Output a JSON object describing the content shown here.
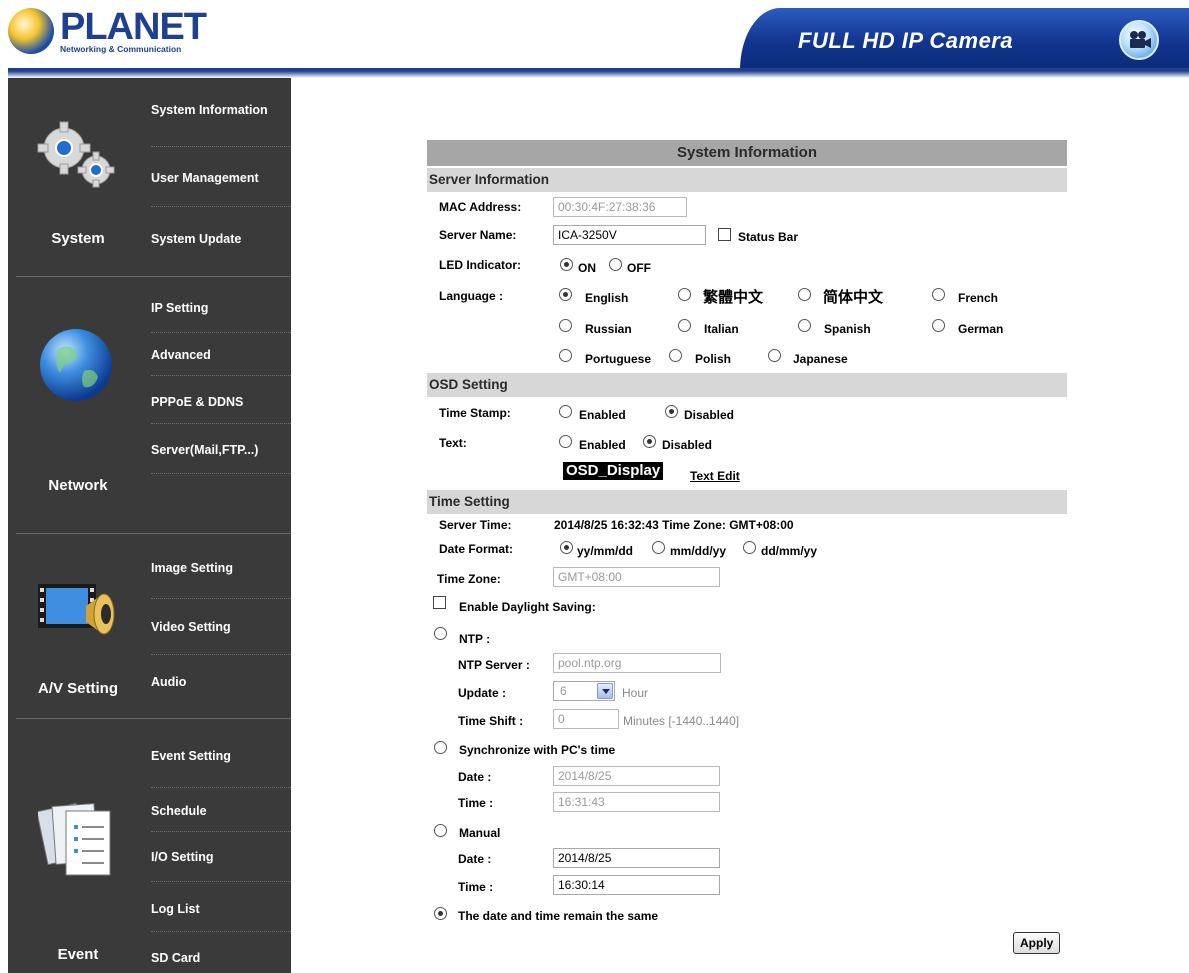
{
  "header": {
    "logo_title": "PLANET",
    "logo_subtitle": "Networking & Communication",
    "product_title": "FULL HD IP Camera"
  },
  "sidebar": {
    "groups": [
      {
        "label": "System",
        "icon": "gears-icon",
        "items": [
          "System Information",
          "User Management",
          "System Update"
        ]
      },
      {
        "label": "Network",
        "icon": "globe-icon",
        "items": [
          "IP Setting",
          "Advanced",
          "PPPoE & DDNS",
          "Server(Mail,FTP...)"
        ]
      },
      {
        "label": "A/V Setting",
        "icon": "film-speaker-icon",
        "items": [
          "Image Setting",
          "Video Setting",
          "Audio"
        ]
      },
      {
        "label": "Event",
        "icon": "documents-icon",
        "items": [
          "Event Setting",
          "Schedule",
          "I/O Setting",
          "Log List",
          "SD Card"
        ]
      }
    ]
  },
  "form": {
    "title": "System Information",
    "server_info": {
      "section": "Server Information",
      "mac_label": "MAC Address:",
      "mac_value": "00:30:4F:27:38:36",
      "name_label": "Server Name:",
      "name_value": "ICA-3250V",
      "status_bar_label": "Status Bar",
      "status_bar_checked": false,
      "led_label": "LED Indicator:",
      "led_on": "ON",
      "led_off": "OFF",
      "led_selected": "ON",
      "language_label": "Language :",
      "languages": [
        "English",
        "繁體中文",
        "简体中文",
        "French",
        "Russian",
        "Italian",
        "Spanish",
        "German",
        "Portuguese",
        "Polish",
        "Japanese"
      ],
      "language_selected": "English"
    },
    "osd": {
      "section": "OSD Setting",
      "timestamp_label": "Time Stamp:",
      "timestamp_enabled": "Enabled",
      "timestamp_disabled": "Disabled",
      "timestamp_selected": "Disabled",
      "text_label": "Text:",
      "text_enabled": "Enabled",
      "text_disabled": "Disabled",
      "text_selected": "Disabled",
      "osd_display": "OSD_Display",
      "text_edit": "Text Edit"
    },
    "time": {
      "section": "Time Setting",
      "server_time_label": "Server Time:",
      "server_time_value": "2014/8/25 16:32:43 Time Zone: GMT+08:00",
      "date_format_label": "Date Format:",
      "date_formats": [
        "yy/mm/dd",
        "mm/dd/yy",
        "dd/mm/yy"
      ],
      "date_format_selected": "yy/mm/dd",
      "time_zone_label": "Time Zone:",
      "time_zone_value": "GMT+08:00",
      "dst_label": "Enable Daylight Saving:",
      "dst_checked": false,
      "ntp_label": "NTP :",
      "ntp_server_label": "NTP Server :",
      "ntp_server_value": "pool.ntp.org",
      "update_label": "Update :",
      "update_value": "6",
      "update_unit": "Hour",
      "shift_label": "Time Shift :",
      "shift_value": "0",
      "shift_unit": "Minutes  [-1440..1440]",
      "sync_pc_label": "Synchronize with PC's time",
      "pc_date_label": "Date :",
      "pc_date_value": "2014/8/25",
      "pc_time_label": "Time :",
      "pc_time_value": "16:31:43",
      "manual_label": "Manual",
      "manual_date_label": "Date :",
      "manual_date_value": "2014/8/25",
      "manual_time_label": "Time :",
      "manual_time_value": "16:30:14",
      "remain_label": "The date and time remain the same",
      "mode_selected": "remain"
    },
    "apply_label": "Apply"
  }
}
